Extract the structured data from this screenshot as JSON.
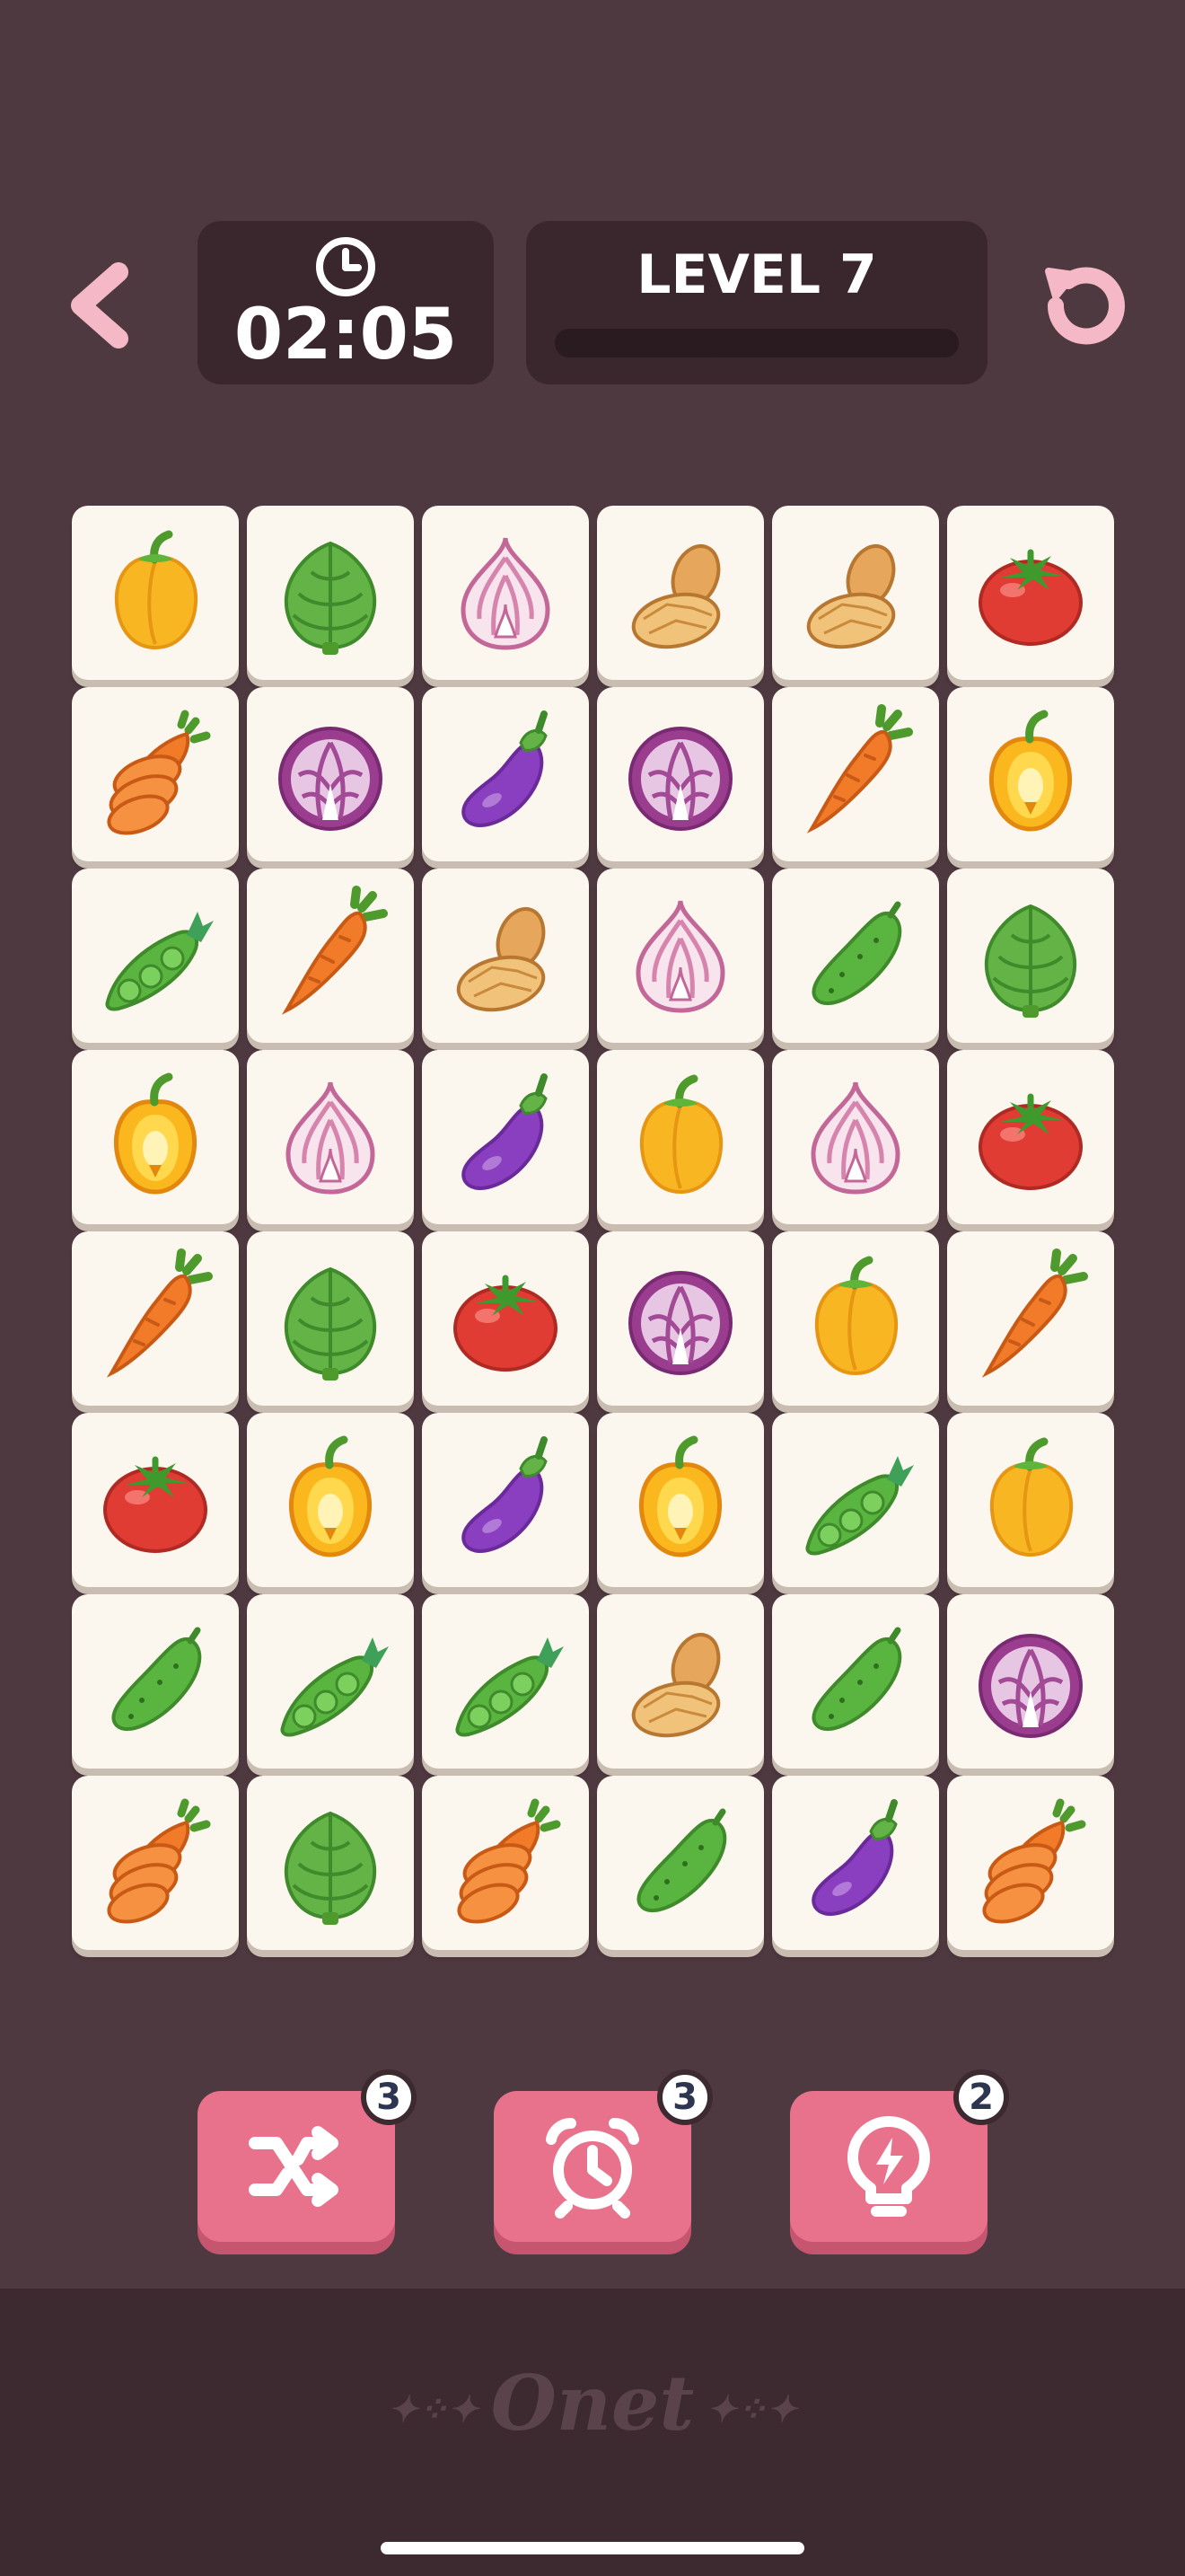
{
  "header": {
    "timer": "02:05",
    "level": "LEVEL 7",
    "level_stars_earned": 0,
    "level_stars_total": 3
  },
  "board": {
    "rows": [
      [
        "pepper-yellow",
        "artichoke",
        "onion",
        "peanut",
        "peanut",
        "tomato"
      ],
      [
        "carrot-sliced",
        "cabbage",
        "eggplant",
        "cabbage",
        "carrot",
        "pepper-half"
      ],
      [
        "peas",
        "carrot",
        "peanut",
        "onion",
        "cucumber",
        "artichoke"
      ],
      [
        "pepper-half",
        "onion",
        "eggplant",
        "pepper-yellow",
        "onion",
        "tomato"
      ],
      [
        "carrot",
        "artichoke",
        "tomato",
        "cabbage",
        "pepper-yellow",
        "carrot"
      ],
      [
        "tomato",
        "pepper-half",
        "eggplant",
        "pepper-half",
        "peas",
        "pepper-yellow"
      ],
      [
        "cucumber",
        "peas",
        "peas",
        "peanut",
        "cucumber",
        "cabbage"
      ],
      [
        "carrot-sliced",
        "artichoke",
        "carrot-sliced",
        "cucumber",
        "eggplant",
        "carrot-sliced"
      ]
    ]
  },
  "boosters": [
    {
      "name": "shuffle-icon",
      "count": "3"
    },
    {
      "name": "alarm-clock-icon",
      "count": "3"
    },
    {
      "name": "hint-bulb-icon",
      "count": "2"
    }
  ],
  "footer": {
    "logo": "Onet"
  },
  "colors": {
    "background": "#4f3940",
    "panel": "#3a272d",
    "accent": "#e8728b",
    "tile": "#fbf6ee"
  }
}
